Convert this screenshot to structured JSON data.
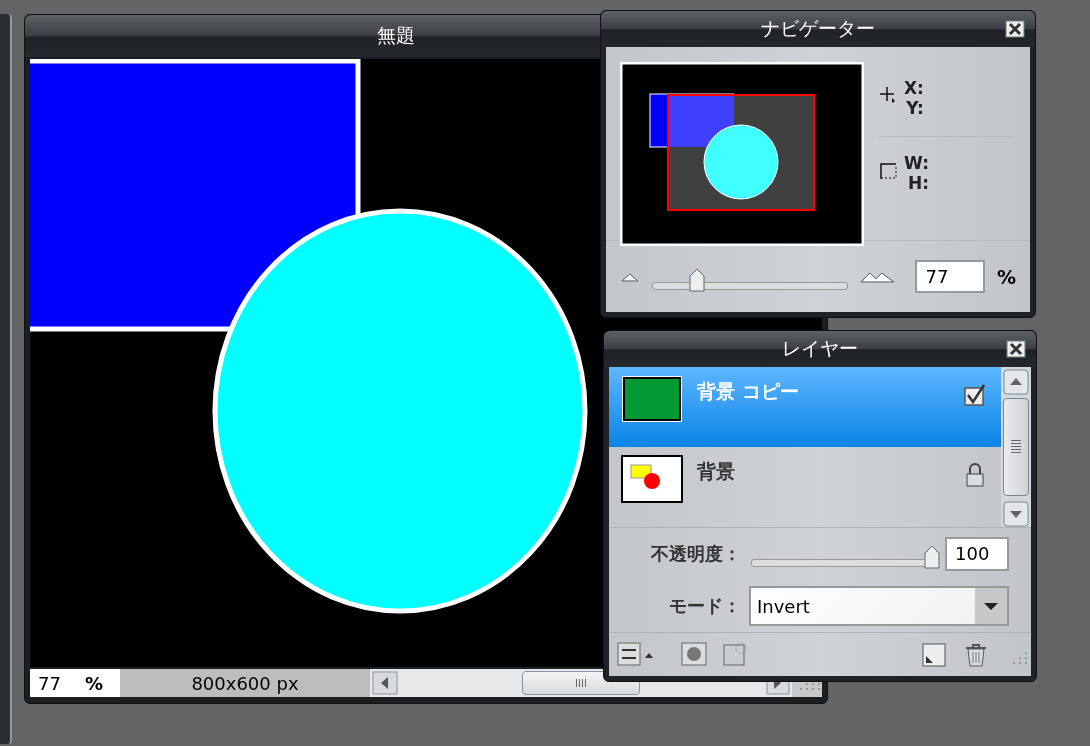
{
  "document": {
    "title": "無題",
    "status_bar": {
      "zoom": "77",
      "zoom_unit": "%",
      "size": "800x600 px"
    }
  },
  "navigator": {
    "title": "ナビゲーター",
    "x_label": "X:",
    "y_label": "Y:",
    "w_label": "W:",
    "h_label": "H:",
    "zoom_slider": {
      "level": 0.23
    },
    "zoom_value": "77",
    "zoom_unit": "%"
  },
  "layers": {
    "title": "レイヤー",
    "items": [
      {
        "name": "背景 コピー",
        "selected": true,
        "kind": "checkbox",
        "checked": true,
        "thumbnail": {
          "kind": "solid",
          "color": "#009933"
        }
      },
      {
        "name": "背景",
        "selected": false,
        "kind": "lock",
        "thumbnail": {
          "kind": "shapes"
        }
      }
    ],
    "opacity": {
      "label": "不透明度：",
      "level": 1,
      "value": "100"
    },
    "mode": {
      "label": "モード：",
      "value": "Invert"
    }
  }
}
